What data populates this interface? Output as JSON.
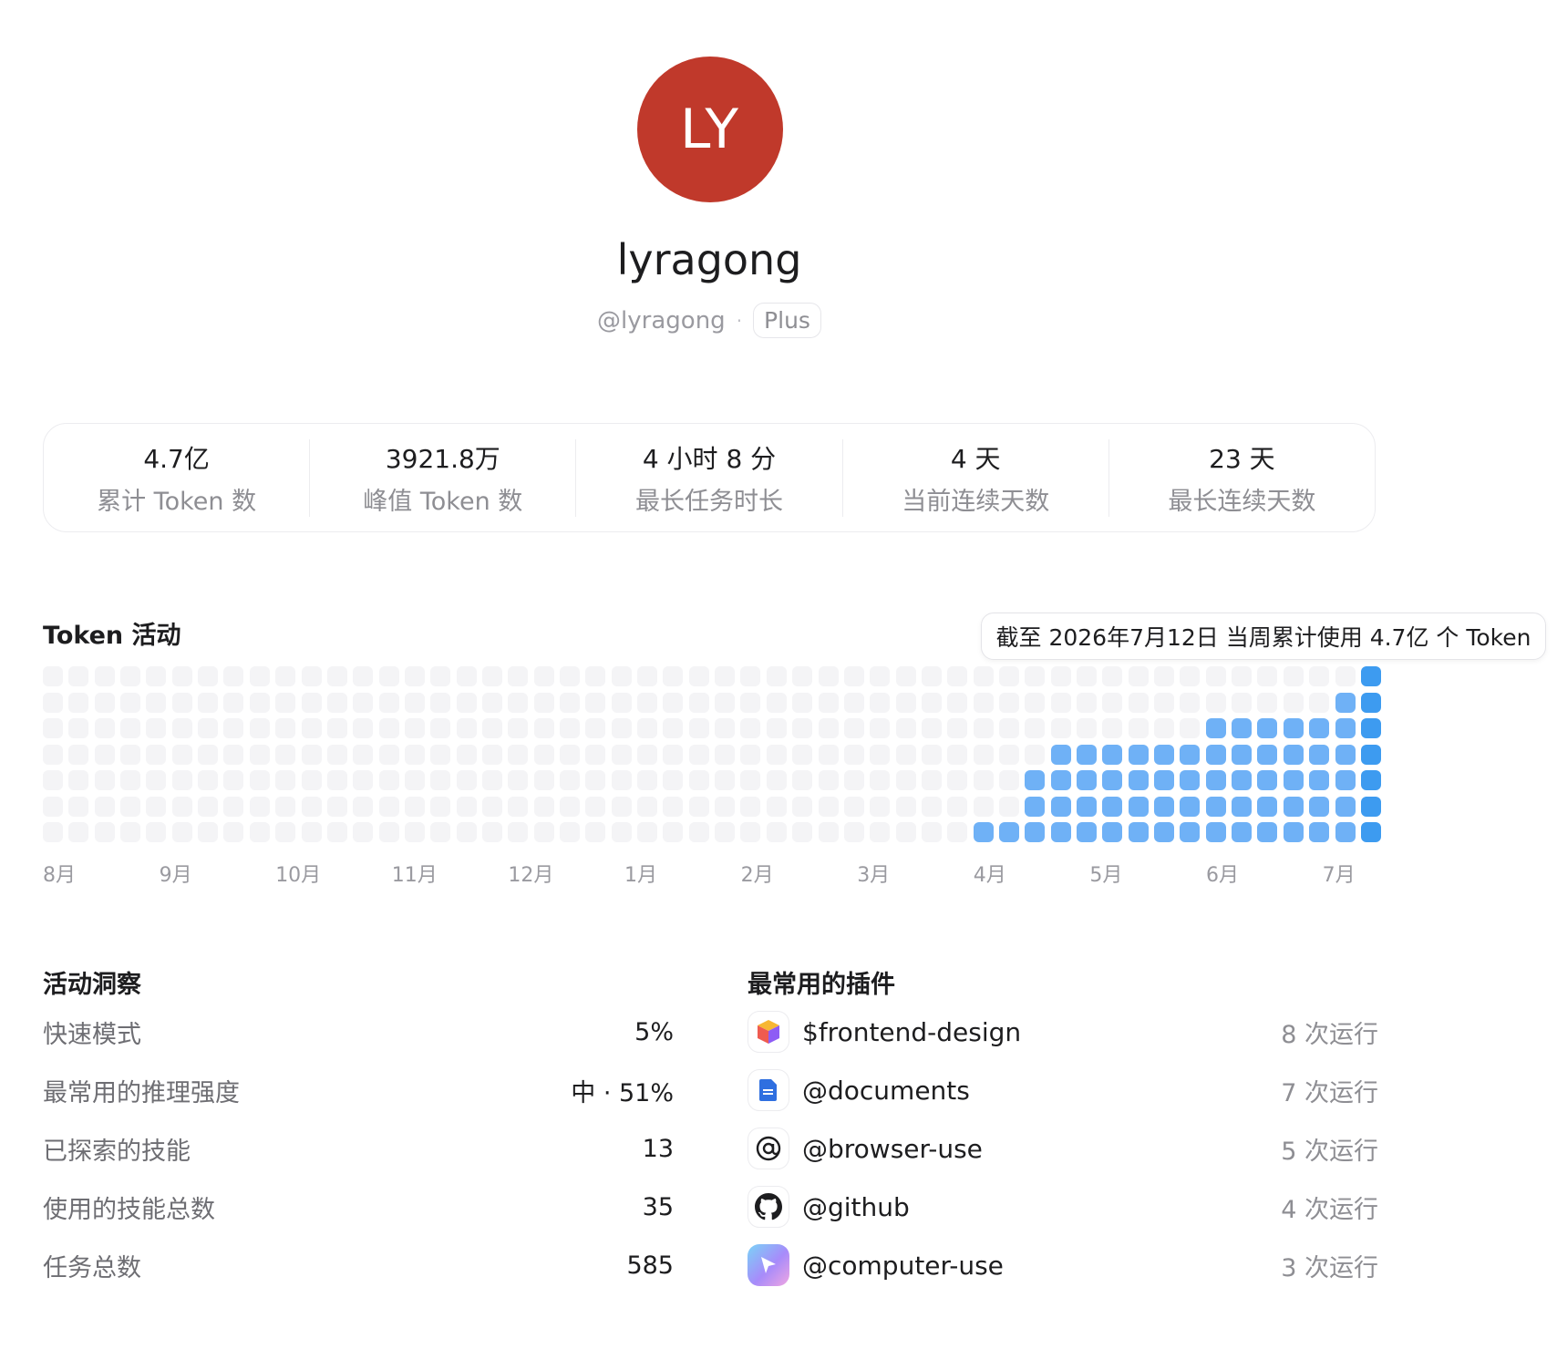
{
  "profile": {
    "initials": "LY",
    "avatar_color": "#c0392b",
    "display_name": "lyragong",
    "handle": "@lyragong",
    "separator": "·",
    "plan": "Plus"
  },
  "stats": [
    {
      "value": "4.7亿",
      "label": "累计 Token 数"
    },
    {
      "value": "3921.8万",
      "label": "峰值 Token 数"
    },
    {
      "value": "4 小时 8 分",
      "label": "最长任务时长"
    },
    {
      "value": "4 天",
      "label": "当前连续天数"
    },
    {
      "value": "23 天",
      "label": "最长连续天数"
    }
  ],
  "activity": {
    "title": "Token 活动",
    "tooltip": "截至 2026年7月12日 当周累计使用 4.7亿 个 Token",
    "months": [
      "8月",
      "9月",
      "10月",
      "11月",
      "12月",
      "1月",
      "2月",
      "3月",
      "4月",
      "5月",
      "6月",
      "7月"
    ],
    "colors": {
      "empty": "#f4f4f6",
      "active": "#6fb1f6",
      "current": "#3d9bf0"
    },
    "weeks": 52,
    "days_per_week": 7,
    "active_cells_per_week": [
      0,
      0,
      0,
      0,
      0,
      0,
      0,
      0,
      0,
      0,
      0,
      0,
      0,
      0,
      0,
      0,
      0,
      0,
      0,
      0,
      0,
      0,
      0,
      0,
      0,
      0,
      0,
      0,
      0,
      0,
      0,
      0,
      0,
      0,
      0,
      0,
      1,
      1,
      3,
      4,
      4,
      4,
      4,
      4,
      4,
      5,
      5,
      5,
      5,
      5,
      6,
      7
    ],
    "current_week_index": 51
  },
  "insights": {
    "title": "活动洞察",
    "rows": [
      {
        "label": "快速模式",
        "value": "5%"
      },
      {
        "label": "最常用的推理强度",
        "value": "中 · 51%"
      },
      {
        "label": "已探索的技能",
        "value": "13"
      },
      {
        "label": "使用的技能总数",
        "value": "35"
      },
      {
        "label": "任务总数",
        "value": "585"
      }
    ]
  },
  "plugins": {
    "title": "最常用的插件",
    "rows": [
      {
        "name": "$frontend-design",
        "runs": "8 次运行",
        "icon": "cube-icon"
      },
      {
        "name": "@documents",
        "runs": "7 次运行",
        "icon": "document-icon"
      },
      {
        "name": "@browser-use",
        "runs": "5 次运行",
        "icon": "at-browser-icon"
      },
      {
        "name": "@github",
        "runs": "4 次运行",
        "icon": "github-icon"
      },
      {
        "name": "@computer-use",
        "runs": "3 次运行",
        "icon": "cursor-icon"
      }
    ]
  }
}
